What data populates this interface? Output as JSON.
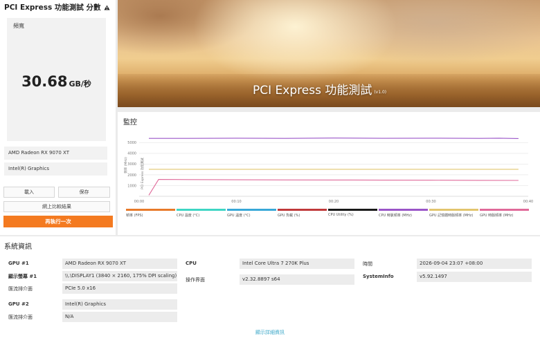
{
  "app": {
    "score_title": "PCI Express 功能測試 分數",
    "warn_icon": "warning-triangle-icon"
  },
  "score": {
    "label": "頻寬",
    "value": "30.68",
    "unit": "GB/秒"
  },
  "devices": [
    "AMD Radeon RX 9070 XT",
    "Intel(R) Graphics"
  ],
  "buttons": {
    "load": "載入",
    "save": "保存",
    "compare_online": "網上比較結果",
    "run_again": "再執行一次"
  },
  "hero": {
    "title": "PCI Express 功能測試",
    "version": "(v1.0)"
  },
  "monitor": {
    "title": "監控",
    "ylabel_freq": "頻率 (MHz)",
    "ylabel_test": "PCI Express 功能測試",
    "legend": [
      {
        "label": "幀率 (FPS)",
        "color": "#e87a2a"
      },
      {
        "label": "CPU 溫度 (°C)",
        "color": "#3fd6c4"
      },
      {
        "label": "GPU 溫度 (°C)",
        "color": "#38a8d8"
      },
      {
        "label": "GPU 負載 (%)",
        "color": "#c0393b"
      },
      {
        "label": "CPU Utility (%)",
        "color": "#1a1a1a"
      },
      {
        "label": "CPU 時脈頻率 (MHz)",
        "color": "#9a55c8"
      },
      {
        "label": "GPU 記憶體時脈頻率 (MHz)",
        "color": "#e2c56e"
      },
      {
        "label": "GPU 時脈頻率 (MHz)",
        "color": "#e06a9a"
      }
    ]
  },
  "chart_data": {
    "type": "line",
    "x_ticks": [
      "00:00",
      "00:10",
      "00:20",
      "00:30",
      "00:40"
    ],
    "y_ticks": [
      1000,
      2000,
      3000,
      4000,
      5000
    ],
    "ylim": [
      0,
      5800
    ],
    "xlim": [
      0,
      40
    ],
    "series": [
      {
        "name": "CPU 時脈頻率 (MHz)",
        "color": "#9a55c8",
        "x": [
          1,
          5,
          10,
          15,
          20,
          25,
          30,
          35,
          37,
          39
        ],
        "values": [
          5400,
          5400,
          5420,
          5400,
          5430,
          5410,
          5420,
          5400,
          5420,
          5390
        ]
      },
      {
        "name": "GPU 記憶體時脈頻率 (MHz)",
        "color": "#e2c56e",
        "x": [
          1,
          39
        ],
        "values": [
          2520,
          2520
        ]
      },
      {
        "name": "GPU 時脈頻率 (MHz)",
        "color": "#e06a9a",
        "x": [
          1,
          2,
          5,
          10,
          15,
          20,
          25,
          30,
          35,
          39
        ],
        "values": [
          100,
          1570,
          1560,
          1540,
          1530,
          1520,
          1510,
          1500,
          1490,
          1480
        ]
      }
    ]
  },
  "sysinfo": {
    "title": "系統資訊",
    "gpu1_label": "GPU #1",
    "gpu1_value": "AMD Radeon RX 9070 XT",
    "display1_label": "顯示螢幕 #1",
    "display1_value": "\\\\.\\DISPLAY1 (3840 × 2160, 175% DPI scaling)",
    "bus1_label": "匯流排介面",
    "bus1_value": "PCIe 5.0 x16",
    "gpu2_label": "GPU #2",
    "gpu2_value": "Intel(R) Graphics",
    "bus2_label": "匯流排介面",
    "bus2_value": "N/A",
    "cpu_label": "CPU",
    "cpu_value": "Intel Core Ultra 7 270K Plus",
    "os_label": "操作界面",
    "os_value": "v2.32.8897 s64",
    "time_label": "時間",
    "time_value": "2026-09-04 23:07 +08:00",
    "systeminfo_label": "SystemInfo",
    "systeminfo_value": "v5.92.1497",
    "details_link": "顯示詳細資訊"
  }
}
